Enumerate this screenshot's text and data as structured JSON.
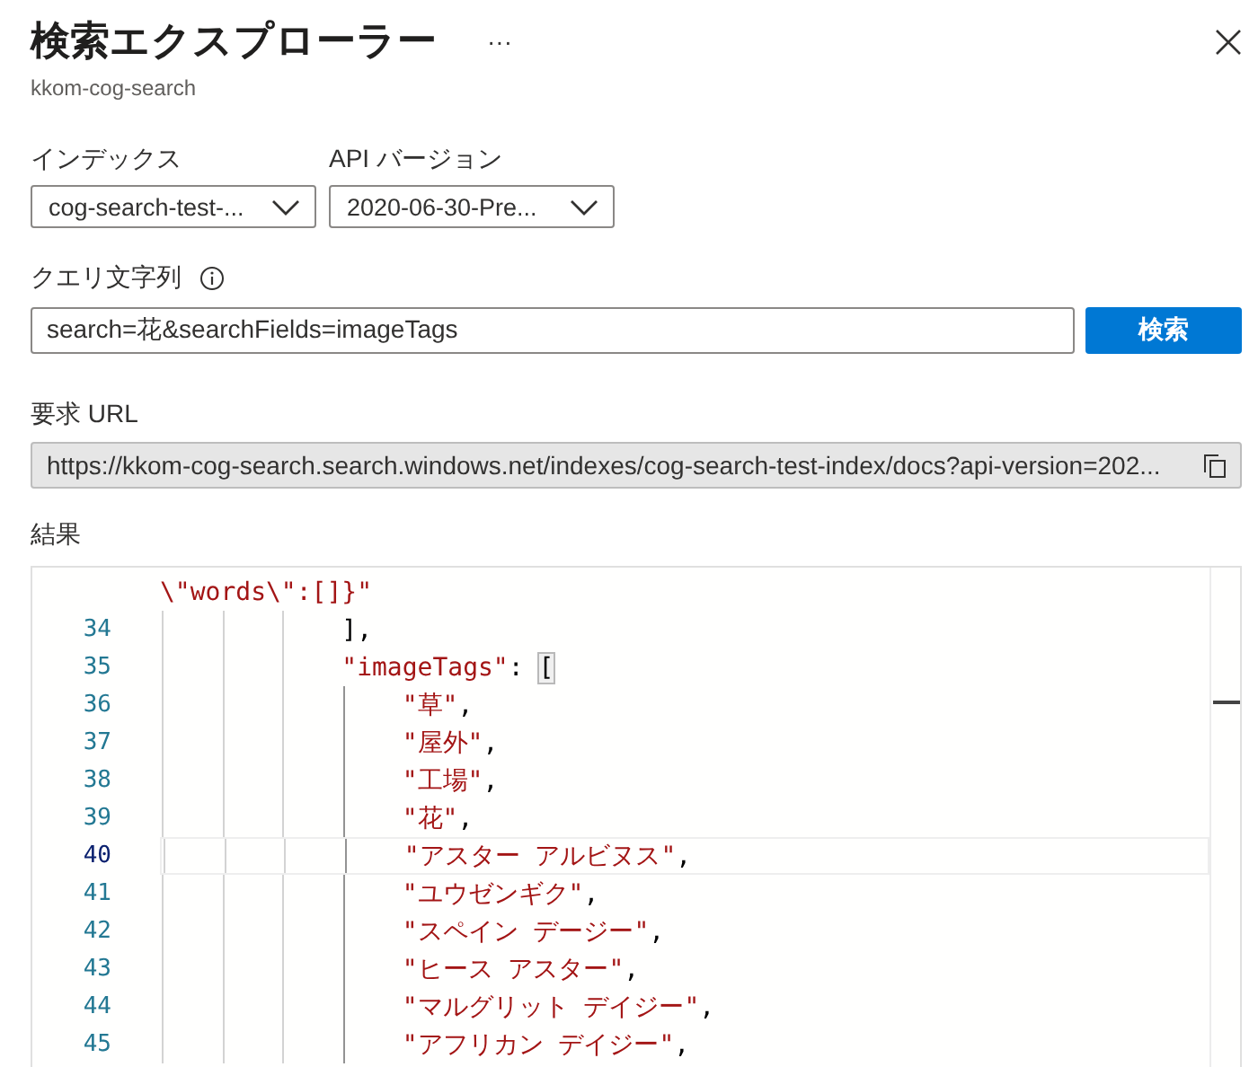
{
  "header": {
    "title": "検索エクスプローラー",
    "more": "···",
    "subtitle": "kkom-cog-search"
  },
  "selectors": [
    {
      "label": "インデックス",
      "value": "cog-search-test-..."
    },
    {
      "label": "API バージョン",
      "value": "2020-06-30-Pre..."
    }
  ],
  "query": {
    "label": "クエリ文字列",
    "value": "search=花&searchFields=imageTags",
    "button": "検索"
  },
  "request_url": {
    "label": "要求 URL",
    "value": "https://kkom-cog-search.search.windows.net/indexes/cog-search-test-index/docs?api-version=202..."
  },
  "results": {
    "label": "結果",
    "lines": [
      {
        "current": false,
        "segments": [
          {
            "kind": "string",
            "text": "\\\"words\\\":[]}\""
          }
        ]
      },
      {
        "number": "34",
        "current": false,
        "segments": [
          {
            "kind": "punct",
            "text": "            ],"
          }
        ]
      },
      {
        "number": "35",
        "current": false,
        "segments": [
          {
            "kind": "string",
            "text": "            \"imageTags\""
          },
          {
            "kind": "punct",
            "text": ": "
          },
          {
            "kind": "bracket",
            "text": "["
          }
        ]
      },
      {
        "number": "36",
        "current": false,
        "segments": [
          {
            "kind": "string",
            "text": "                \"草\""
          },
          {
            "kind": "punct",
            "text": ","
          }
        ]
      },
      {
        "number": "37",
        "current": false,
        "segments": [
          {
            "kind": "string",
            "text": "                \"屋外\""
          },
          {
            "kind": "punct",
            "text": ","
          }
        ]
      },
      {
        "number": "38",
        "current": false,
        "segments": [
          {
            "kind": "string",
            "text": "                \"工場\""
          },
          {
            "kind": "punct",
            "text": ","
          }
        ]
      },
      {
        "number": "39",
        "current": false,
        "segments": [
          {
            "kind": "string",
            "text": "                \"花\""
          },
          {
            "kind": "punct",
            "text": ","
          }
        ]
      },
      {
        "number": "40",
        "current": true,
        "segments": [
          {
            "kind": "string",
            "text": "                \"アスター アルビヌス\""
          },
          {
            "kind": "punct",
            "text": ","
          }
        ]
      },
      {
        "number": "41",
        "current": false,
        "segments": [
          {
            "kind": "string",
            "text": "                \"ユウゼンギク\""
          },
          {
            "kind": "punct",
            "text": ","
          }
        ]
      },
      {
        "number": "42",
        "current": false,
        "segments": [
          {
            "kind": "string",
            "text": "                \"スペイン デージー\""
          },
          {
            "kind": "punct",
            "text": ","
          }
        ]
      },
      {
        "number": "43",
        "current": false,
        "segments": [
          {
            "kind": "string",
            "text": "                \"ヒース アスター\""
          },
          {
            "kind": "punct",
            "text": ","
          }
        ]
      },
      {
        "number": "44",
        "current": false,
        "segments": [
          {
            "kind": "string",
            "text": "                \"マルグリット デイジー\""
          },
          {
            "kind": "punct",
            "text": ","
          }
        ]
      },
      {
        "number": "45",
        "current": false,
        "segments": [
          {
            "kind": "string",
            "text": "                \"アフリカン デイジー\""
          },
          {
            "kind": "punct",
            "text": ","
          }
        ]
      }
    ]
  }
}
